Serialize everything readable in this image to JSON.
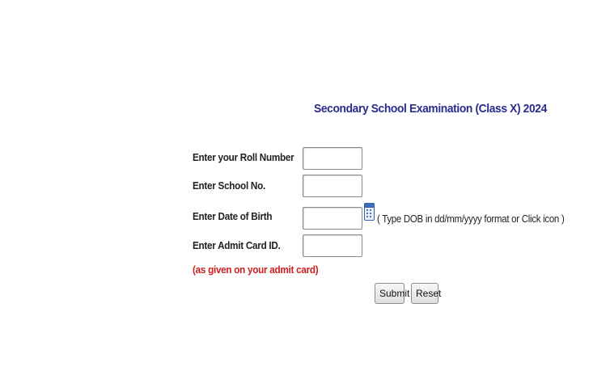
{
  "page": {
    "title": "Secondary School Examination (Class X) 2024"
  },
  "form": {
    "roll_number_label": "Enter your Roll Number",
    "school_no_label": "Enter School No.",
    "dob_label": "Enter Date of Birth",
    "dob_hint": "( Type DOB in dd/mm/yyyy format or Click icon )",
    "admit_card_label": "Enter Admit Card ID.",
    "admit_card_note": "(as given on your admit card)",
    "roll_number_value": "",
    "school_no_value": "",
    "dob_value": "",
    "admit_card_value": ""
  },
  "buttons": {
    "submit_label": "Submit",
    "reset_label": "Reset"
  },
  "icons": {
    "date_picker": "calendar-icon"
  },
  "colors": {
    "title": "#2b2b8f",
    "note": "#cc1f1f",
    "label": "#222222"
  }
}
